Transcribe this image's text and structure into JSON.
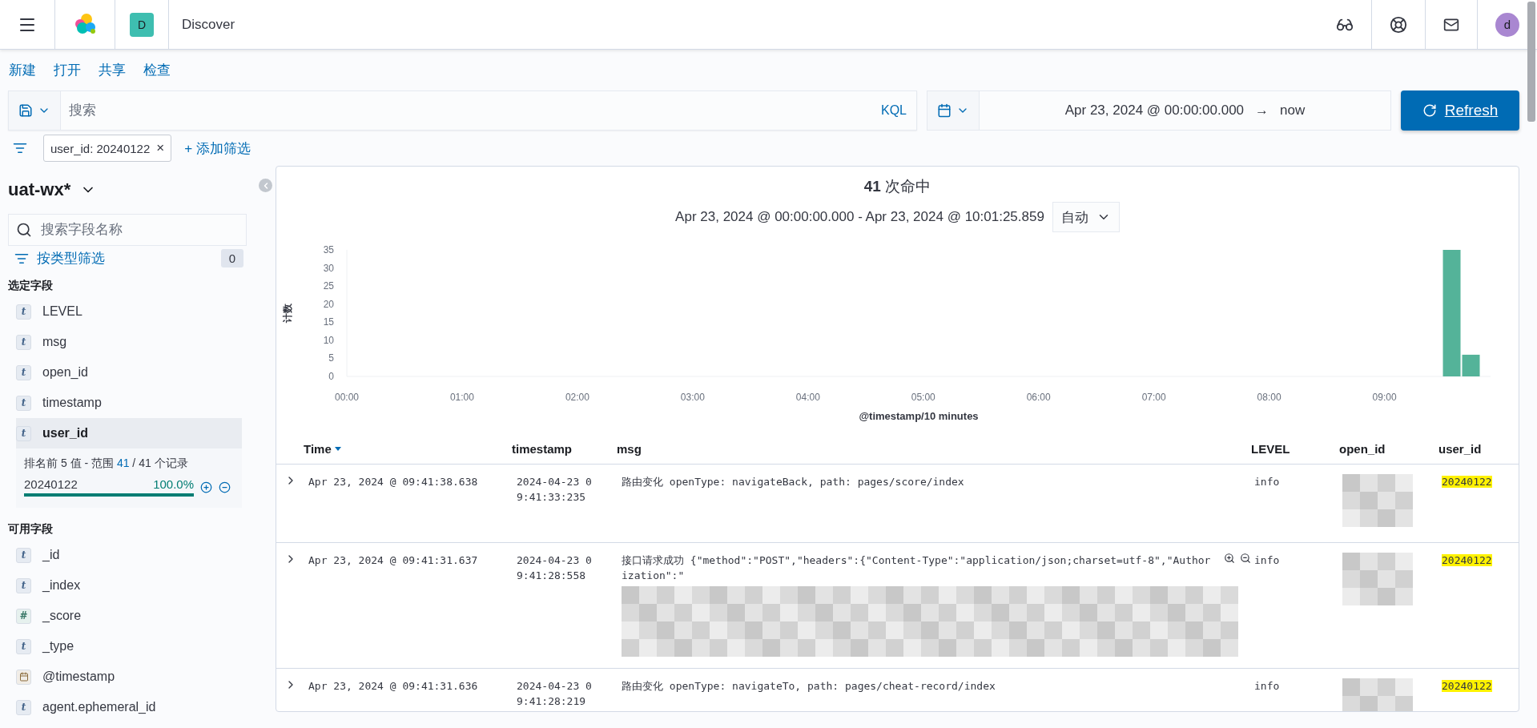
{
  "header": {
    "space_badge": "D",
    "app_title": "Discover",
    "avatar": "d"
  },
  "top_menu": [
    "新建",
    "打开",
    "共享",
    "检查"
  ],
  "query": {
    "placeholder": "搜索",
    "language": "KQL"
  },
  "time_range": {
    "start": "Apr 23, 2024 @ 00:00:00.000",
    "arrow": "→",
    "end": "now"
  },
  "refresh_button": "Refresh",
  "filters": [
    {
      "label": "user_id: 20240122",
      "close": "×"
    }
  ],
  "add_filter": "+ 添加筛选",
  "sidebar": {
    "index_pattern": "uat-wx*",
    "search_placeholder": "搜索字段名称",
    "type_filter": "按类型筛选",
    "type_filter_count": "0",
    "selected_heading": "选定字段",
    "selected_fields": [
      {
        "kind": "string",
        "icon": "t",
        "name": "LEVEL",
        "expanded": false
      },
      {
        "kind": "string",
        "icon": "t",
        "name": "msg",
        "expanded": false
      },
      {
        "kind": "string",
        "icon": "t",
        "name": "open_id",
        "expanded": false
      },
      {
        "kind": "string",
        "icon": "t",
        "name": "timestamp",
        "expanded": false
      },
      {
        "kind": "string",
        "icon": "t",
        "name": "user_id",
        "expanded": true,
        "details": {
          "summary_prefix": "排名前 5 值 - 范围 ",
          "summary_link": "41",
          "summary_suffix": " / 41 个记录",
          "top_values": [
            {
              "value": "20240122",
              "percent": "100.0%",
              "level": 1
            }
          ]
        }
      }
    ],
    "available_heading": "可用字段",
    "available_fields": [
      {
        "kind": "string",
        "icon": "t",
        "name": "_id",
        "expanded": false
      },
      {
        "kind": "string",
        "icon": "t",
        "name": "_index",
        "expanded": false
      },
      {
        "kind": "number",
        "icon": "#",
        "name": "_score",
        "expanded": false
      },
      {
        "kind": "string",
        "icon": "t",
        "name": "_type",
        "expanded": false
      },
      {
        "kind": "date",
        "name": "@timestamp",
        "expanded": false
      },
      {
        "kind": "string",
        "icon": "t",
        "name": "agent.ephemeral_id",
        "expanded": false
      }
    ]
  },
  "histogram": {
    "hits": "41",
    "hits_label": "次命中",
    "range": "Apr 23, 2024 @ 00:00:00.000 - Apr 23, 2024 @ 10:01:25.859",
    "interval": "自动",
    "chart_data": {
      "type": "bar",
      "xlabel": "@timestamp/10 minutes",
      "ylabel": "计数",
      "x": [
        9.5833,
        9.75
      ],
      "series": [
        {
          "color": "#54b399",
          "values": [
            35,
            6
          ]
        }
      ],
      "xlim": [
        0,
        9.92
      ],
      "ylim": [
        0,
        35
      ],
      "xticks": [
        {
          "value": 0,
          "label": "00:00"
        },
        {
          "value": 1,
          "label": "01:00"
        },
        {
          "value": 2,
          "label": "02:00"
        },
        {
          "value": 3,
          "label": "03:00"
        },
        {
          "value": 4,
          "label": "04:00"
        },
        {
          "value": 5,
          "label": "05:00"
        },
        {
          "value": 6,
          "label": "06:00"
        },
        {
          "value": 7,
          "label": "07:00"
        },
        {
          "value": 8,
          "label": "08:00"
        },
        {
          "value": 9,
          "label": "09:00"
        }
      ],
      "yticks": [
        0,
        5,
        10,
        15,
        20,
        25,
        30,
        35
      ]
    }
  },
  "table": {
    "columns": [
      {
        "label": "Time",
        "sorted": true
      },
      {
        "label": "timestamp",
        "sorted": false
      },
      {
        "label": "msg",
        "sorted": false
      },
      {
        "label": "LEVEL",
        "sorted": false
      },
      {
        "label": "open_id",
        "sorted": false
      },
      {
        "label": "user_id",
        "sorted": false
      }
    ],
    "rows": [
      {
        "time": "Apr 23, 2024 @ 09:41:38.638",
        "timestamp": "2024-04-23 09:41:33:235",
        "msg": "路由变化 openType: navigateBack, path: pages/score/index",
        "msg_redacted": false,
        "hovered": false,
        "level": "info",
        "open_id_redacted": true,
        "user_id": "20240122",
        "highlighted": true
      },
      {
        "time": "Apr 23, 2024 @ 09:41:31.637",
        "timestamp": "2024-04-23 09:41:28:558",
        "msg": "接口请求成功 {\"method\":\"POST\",\"headers\":{\"Content-Type\":\"application/json;charset=utf-8\",\"Authorization\":\"",
        "msg_redacted": true,
        "hovered": true,
        "level": "info",
        "open_id_redacted": true,
        "user_id": "20240122",
        "highlighted": true
      },
      {
        "time": "Apr 23, 2024 @ 09:41:31.636",
        "timestamp": "2024-04-23 09:41:28:219",
        "msg": "路由变化 openType: navigateTo, path: pages/cheat-record/index",
        "msg_redacted": false,
        "hovered": false,
        "level": "info",
        "open_id_redacted": true,
        "user_id": "20240122",
        "highlighted": true
      }
    ]
  }
}
